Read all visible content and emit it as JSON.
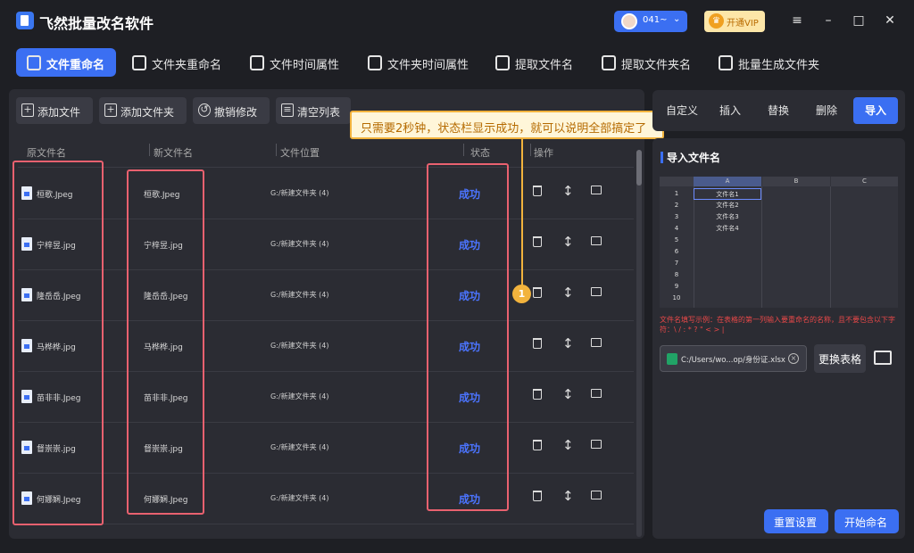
{
  "app": {
    "title": "飞然批量改名软件"
  },
  "titlebar": {
    "user_name": "041~",
    "vip_label": "开通VIP",
    "vip_icon": "crown-icon"
  },
  "tabs": [
    {
      "label": "文件重命名",
      "active": true
    },
    {
      "label": "文件夹重命名"
    },
    {
      "label": "文件时间属性"
    },
    {
      "label": "文件夹时间属性"
    },
    {
      "label": "提取文件名"
    },
    {
      "label": "提取文件夹名"
    },
    {
      "label": "批量生成文件夹"
    }
  ],
  "toolbar": {
    "add_file": "添加文件",
    "add_folder": "添加文件夹",
    "undo": "撤销修改",
    "clear": "清空列表"
  },
  "columns": {
    "orig": "原文件名",
    "new": "新文件名",
    "path": "文件位置",
    "status": "状态",
    "action": "操作"
  },
  "rows": [
    {
      "orig": "桓歌.Jpeg",
      "new": "桓歌.Jpeg",
      "path": "G:/新建文件夹 (4)",
      "status": "成功"
    },
    {
      "orig": "宁梓昱.jpg",
      "new": "宁梓昱.jpg",
      "path": "G:/新建文件夹 (4)",
      "status": "成功"
    },
    {
      "orig": "隆岳岳.Jpeg",
      "new": "隆岳岳.Jpeg",
      "path": "G:/新建文件夹 (4)",
      "status": "成功"
    },
    {
      "orig": "马桦桦.jpg",
      "new": "马桦桦.jpg",
      "path": "G:/新建文件夹 (4)",
      "status": "成功"
    },
    {
      "orig": "苗非非.Jpeg",
      "new": "苗非非.Jpeg",
      "path": "G:/新建文件夹 (4)",
      "status": "成功"
    },
    {
      "orig": "督崇崇.jpg",
      "new": "督崇崇.jpg",
      "path": "G:/新建文件夹 (4)",
      "status": "成功"
    },
    {
      "orig": "何娜娴.Jpeg",
      "new": "何娜娴.Jpeg",
      "path": "G:/新建文件夹 (4)",
      "status": "成功"
    }
  ],
  "callout": {
    "text": "只需要2秒钟，状态栏显示成功，就可以说明全部搞定了",
    "badge": "1"
  },
  "right_tabs": {
    "custom": "自定义",
    "insert": "插入",
    "replace": "替换",
    "delete": "删除",
    "import": "导入"
  },
  "import_panel": {
    "title": "导入文件名",
    "sheet": {
      "columns": [
        "A",
        "B",
        "C"
      ],
      "row_numbers": [
        "1",
        "2",
        "3",
        "4",
        "5",
        "6",
        "7",
        "8",
        "9",
        "10"
      ],
      "cells": [
        "文件名1",
        "文件名2",
        "文件名3",
        "文件名4"
      ]
    },
    "hint": "文件名填写示例：在表格的第一列输入要重命名的名称，且不要包含以下字符：\\ / : * ? \" < > |",
    "file_path": "C:/Users/wo...op/身份证.xlsx",
    "replace_button": "更换表格"
  },
  "bottom": {
    "reset": "重置设置",
    "start": "开始命名"
  },
  "colors": {
    "accent": "#3b6ff2",
    "success": "#4b74ff",
    "highlight": "#e9616f",
    "callout": "#f2b33d"
  }
}
